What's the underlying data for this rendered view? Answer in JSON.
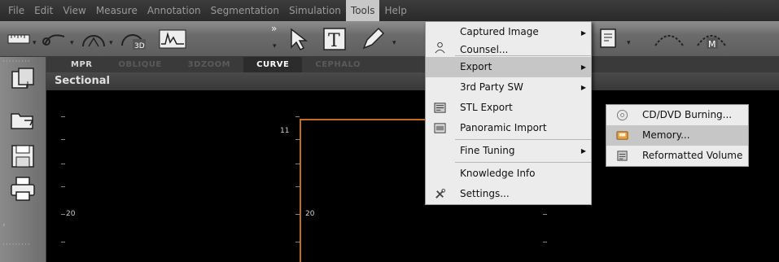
{
  "menubar": {
    "items": [
      "File",
      "Edit",
      "View",
      "Measure",
      "Annotation",
      "Segmentation",
      "Simulation",
      "Tools",
      "Help"
    ],
    "active": "Tools"
  },
  "toolbar": {
    "overflow_label": "»"
  },
  "tabs": [
    "MPR",
    "OBLIQUE",
    "3DZOOM",
    "CURVE",
    "CEPHALO"
  ],
  "active_tab": "CURVE",
  "section_title": "Sectional",
  "viewport": {
    "label_top": "11",
    "label_left": "20",
    "label_mid": "20"
  },
  "tools_menu": {
    "items": [
      {
        "label": "Captured Image",
        "has_submenu": true,
        "icon": "none"
      },
      {
        "label": "Counsel...",
        "has_submenu": false,
        "icon": "person-icon"
      },
      {
        "label": "Export",
        "has_submenu": true,
        "icon": "none",
        "highlighted": true
      },
      {
        "label": "3rd Party SW",
        "has_submenu": true,
        "icon": "none"
      },
      {
        "label": "STL Export",
        "has_submenu": false,
        "icon": "stl-icon"
      },
      {
        "label": "Panoramic Import",
        "has_submenu": false,
        "icon": "panoramic-icon"
      },
      {
        "label": "Fine Tuning",
        "has_submenu": true,
        "icon": "none"
      },
      {
        "label": "Knowledge Info",
        "has_submenu": false,
        "icon": "none"
      },
      {
        "label": "Settings...",
        "has_submenu": false,
        "icon": "tools-icon"
      }
    ]
  },
  "export_submenu": {
    "items": [
      {
        "label": "CD/DVD Burning...",
        "icon": "disc-icon"
      },
      {
        "label": "Memory...",
        "icon": "memory-icon",
        "highlighted": true
      },
      {
        "label": "Reformatted Volume",
        "icon": "volume-icon"
      }
    ]
  },
  "colors": {
    "accent_orange": "#c07020",
    "menu_bg": "#ececec",
    "menu_highlight": "#c6c6c6"
  }
}
